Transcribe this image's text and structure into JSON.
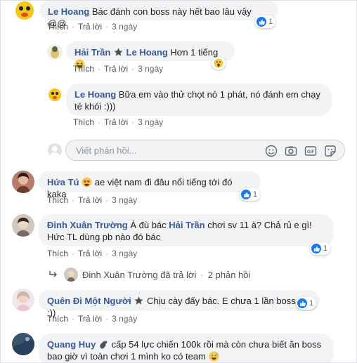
{
  "comments": [
    {
      "name": "Le Hoang",
      "text": "Bác đánh con boss này hết bao lâu vậy @@",
      "like": "Thích",
      "reply": "Trả lời",
      "time": "3 ngày",
      "react_count": "1"
    },
    {
      "name": "Hải Trần",
      "text": "Le Hoang Hơn 1 tiếng",
      "mention": "Le Hoang",
      "body": "Hơn 1 tiếng",
      "like": "Thích",
      "reply": "Trả lời",
      "time": "3 ngày"
    },
    {
      "name": "Le Hoang",
      "text": "Bữa em vào thử chọt nó 1 phát, nó đánh em chạy té khói :)))",
      "like": "Thích",
      "reply": "Trả lời",
      "time": "3 ngày"
    },
    {
      "name": "Hứa Tú",
      "text": "ae việt nam đi đâu nổi tiếng tới đó kaka",
      "like": "Thích",
      "reply": "Trả lời",
      "time": "3 ngày",
      "react_count": "1"
    },
    {
      "name": "Đinh Xuân Trường",
      "text_a": "Á đù bác",
      "mention": "Hải Trần",
      "text_b": "chơi sv 11 à? Chả rủ e gì! Hức TL dùng pb nào đó bác",
      "like": "Thích",
      "reply": "Trả lời",
      "time": "3 ngày",
      "react_count": "1"
    },
    {
      "name": "Quên Đi Một Người",
      "text": "Chịu cày đấy bác. E chưa 1 lần boss tg :))",
      "like": "Thích",
      "reply": "Trả lời",
      "time": "3 ngày",
      "react_count": "1"
    },
    {
      "name": "Quang Huy",
      "text": "cấp 54 lực chiến 100k rồi mà còn chưa biết ăn boss bao giờ vì toàn chơi 1 mình ko có team"
    }
  ],
  "reply_input": {
    "placeholder": "Viết phản hồi..."
  },
  "replies_summary": {
    "text": "Đinh Xuân Trường đã trả lời",
    "sep": "·",
    "count": "2 phản hồi"
  },
  "colors": {
    "link": "#385898",
    "bubble": "#f2f3f5",
    "like_blue": "#1877f2"
  },
  "icons": [
    "emoji-icon",
    "camera-icon",
    "gif-icon",
    "sticker-icon",
    "like-icon",
    "haha-icon",
    "wow-icon",
    "love-eyes-icon",
    "wave-icon",
    "star-badge-icon",
    "reply-arrow-icon"
  ]
}
